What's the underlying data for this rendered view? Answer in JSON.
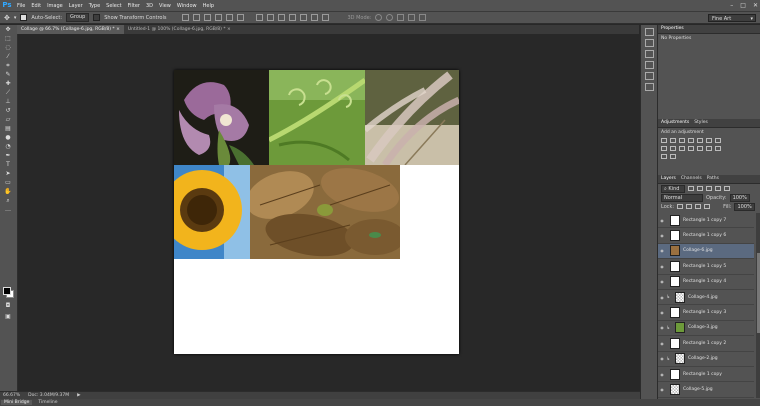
{
  "menu": {
    "logo": "Ps",
    "items": [
      "File",
      "Edit",
      "Image",
      "Layer",
      "Type",
      "Select",
      "Filter",
      "3D",
      "View",
      "Window",
      "Help"
    ]
  },
  "options": {
    "auto_select_label": "Auto-Select:",
    "auto_select_value": "Group",
    "show_transform_label": "Show Transform Controls",
    "mode_3d_label": "3D Mode:",
    "workspace": "Fine Art"
  },
  "tabs": [
    {
      "label": "Collage @ 66.7% (Collage-6.jpg, RGB/8) * ×",
      "active": true
    },
    {
      "label": "Untitled-1 @ 100% (Collage-6.jpg, RGB/8) * ×",
      "active": false
    }
  ],
  "status": {
    "zoom": "66.67%",
    "doc": "Doc: 3.04M/9.37M",
    "arrow": "▶"
  },
  "bottom_tabs": [
    "Mini Bridge",
    "Timeline"
  ],
  "panels": {
    "properties_title": "Properties",
    "properties_body": "No Properties",
    "adjustments_title": "Adjustments",
    "adjustments_styles_tab": "Styles",
    "adjustments_body": "Add an adjustment",
    "layers_tabs": [
      "Layers",
      "Channels",
      "Paths"
    ],
    "kind_label": "Kind",
    "blend_mode": "Normal",
    "opacity_label": "Opacity:",
    "opacity_value": "100%",
    "lock_label": "Lock:",
    "fill_label": "Fill:",
    "fill_value": "100%"
  },
  "layers": [
    {
      "name": "Rectangle 1 copy 7",
      "thumb": "white",
      "clipped": false,
      "selected": false
    },
    {
      "name": "Rectangle 1 copy 6",
      "thumb": "white",
      "clipped": false,
      "selected": false
    },
    {
      "name": "Collage-6.jpg",
      "thumb": "photo-leaf",
      "clipped": false,
      "selected": true
    },
    {
      "name": "Rectangle 1 copy 5",
      "thumb": "white",
      "clipped": false,
      "selected": false
    },
    {
      "name": "Rectangle 1 copy 4",
      "thumb": "white",
      "clipped": false,
      "selected": false
    },
    {
      "name": "Collage-4.jpg",
      "thumb": "check",
      "clipped": true,
      "selected": false
    },
    {
      "name": "Rectangle 1 copy 3",
      "thumb": "white",
      "clipped": false,
      "selected": false
    },
    {
      "name": "Collage-3.jpg",
      "thumb": "photo-green",
      "clipped": true,
      "selected": false
    },
    {
      "name": "Rectangle 1 copy 2",
      "thumb": "white",
      "clipped": false,
      "selected": false
    },
    {
      "name": "Collage-2.jpg",
      "thumb": "check",
      "clipped": true,
      "selected": false
    },
    {
      "name": "Rectangle 1 copy",
      "thumb": "white",
      "clipped": false,
      "selected": false
    },
    {
      "name": "Collage-5.jpg",
      "thumb": "check",
      "clipped": false,
      "selected": false
    }
  ],
  "colors": {
    "accent": "#31a8ff",
    "panel": "#535353",
    "selected_layer": "#5b6a80"
  }
}
